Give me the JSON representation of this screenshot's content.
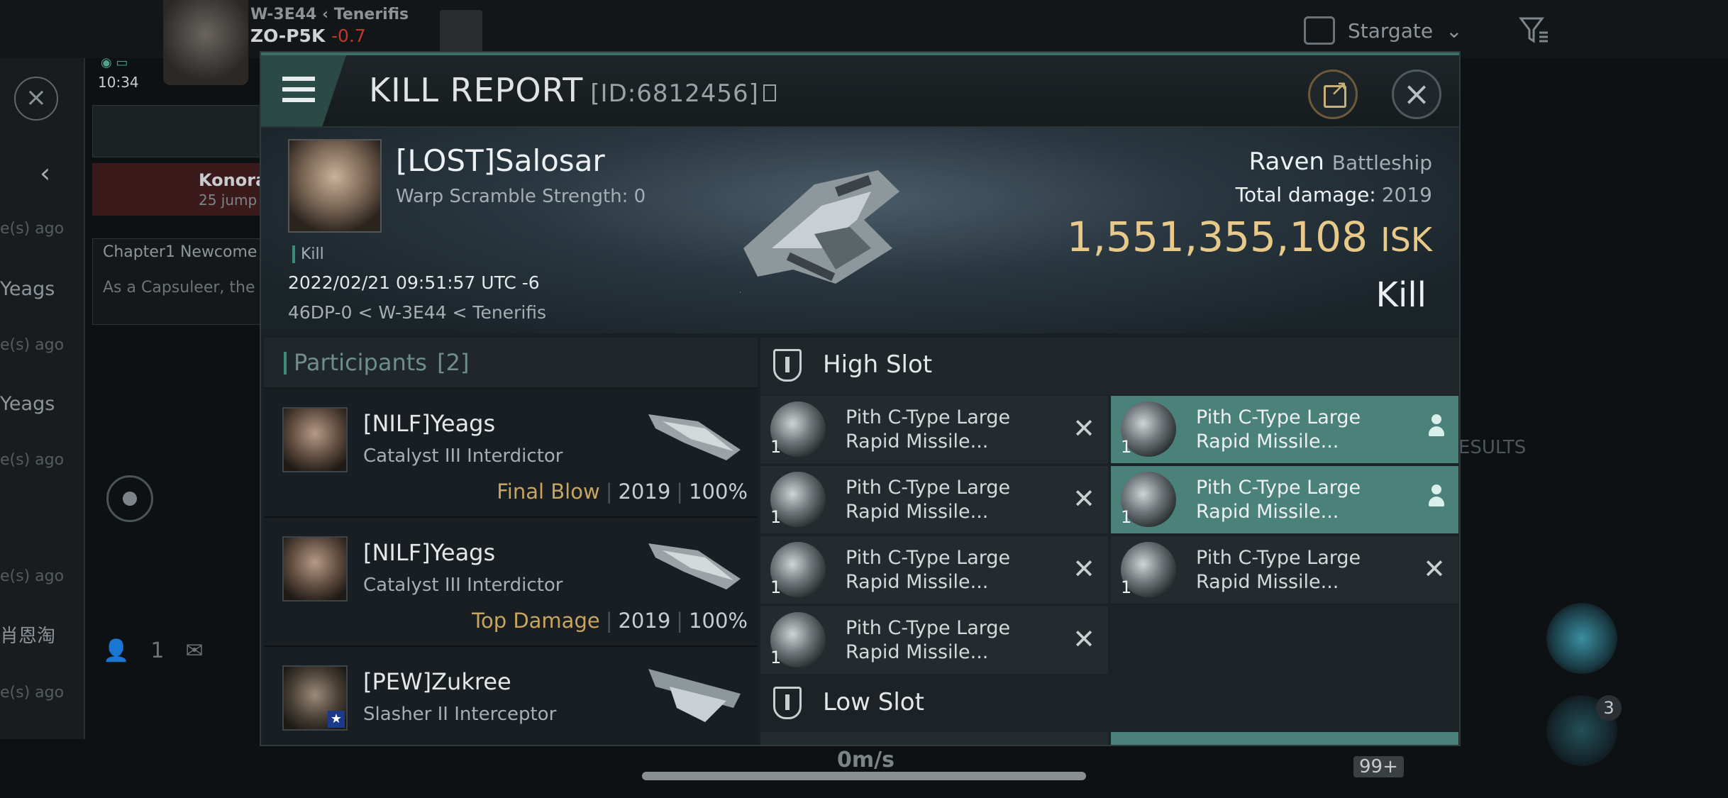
{
  "background": {
    "location_top": "W-3E44 ‹ Tenerifis",
    "system": "ZO-P5K",
    "security": "-0.7",
    "time": "10:34",
    "stargate_label": "Stargate",
    "konora_title": "Konora",
    "konora_sub": "25 jump",
    "chapter_title": "Chapter1 Newcome",
    "chapter_body": "As a Capsuleer, the",
    "ago_label": "e(s) ago",
    "yeag_label": "Yeags",
    "cn_name": "肖恩淘",
    "people_count": "1",
    "results_label": "ESULTS",
    "speed": "0m/s",
    "badge": "99+",
    "module_count": "3"
  },
  "modal": {
    "title": "KILL REPORT",
    "id_text": "[ID:6812456]"
  },
  "victim": {
    "name": "[LOST]Salosar",
    "warp_scramble": "Warp Scramble Strength: 0",
    "tag": "Kill",
    "date": "2022/02/21 09:51:57 UTC -6",
    "location": "46DP-0 < W-3E44 < Tenerifis",
    "ship_name": "Raven",
    "ship_class": "Battleship",
    "total_damage_label": "Total damage:",
    "total_damage_value": "2019",
    "isk_value": "1,551,355,108",
    "isk_unit": "ISK",
    "result": "Kill"
  },
  "participants": {
    "header_label": "Participants",
    "header_count": "[2]",
    "rows": [
      {
        "name": "[NILF]Yeags",
        "ship": "Catalyst III Interdictor",
        "tag": "Final Blow",
        "damage": "2019",
        "percent": "100%"
      },
      {
        "name": "[NILF]Yeags",
        "ship": "Catalyst III Interdictor",
        "tag": "Top Damage",
        "damage": "2019",
        "percent": "100%"
      },
      {
        "name": "[PEW]Zukree",
        "ship": "Slasher II Interceptor"
      }
    ]
  },
  "high_slot": {
    "label": "High Slot",
    "modules": [
      {
        "name": "Pith C-Type Large Rapid Missile...",
        "qty": "1",
        "status": "destroyed"
      },
      {
        "name": "Pith C-Type Large Rapid Missile...",
        "qty": "1",
        "status": "dropped"
      },
      {
        "name": "Pith C-Type Large Rapid Missile...",
        "qty": "1",
        "status": "destroyed"
      },
      {
        "name": "Pith C-Type Large Rapid Missile...",
        "qty": "1",
        "status": "dropped"
      },
      {
        "name": "Pith C-Type Large Rapid Missile...",
        "qty": "1",
        "status": "destroyed"
      },
      {
        "name": "Pith C-Type Large Rapid Missile...",
        "qty": "1",
        "status": "destroyed"
      },
      {
        "name": "Pith C-Type Large Rapid Missile...",
        "qty": "1",
        "status": "destroyed"
      }
    ]
  },
  "low_slot": {
    "label": "Low Slot"
  },
  "colors": {
    "accent_teal": "#4a8178",
    "isk_gold": "#e7c98a",
    "tag_gold": "#c7a460"
  }
}
